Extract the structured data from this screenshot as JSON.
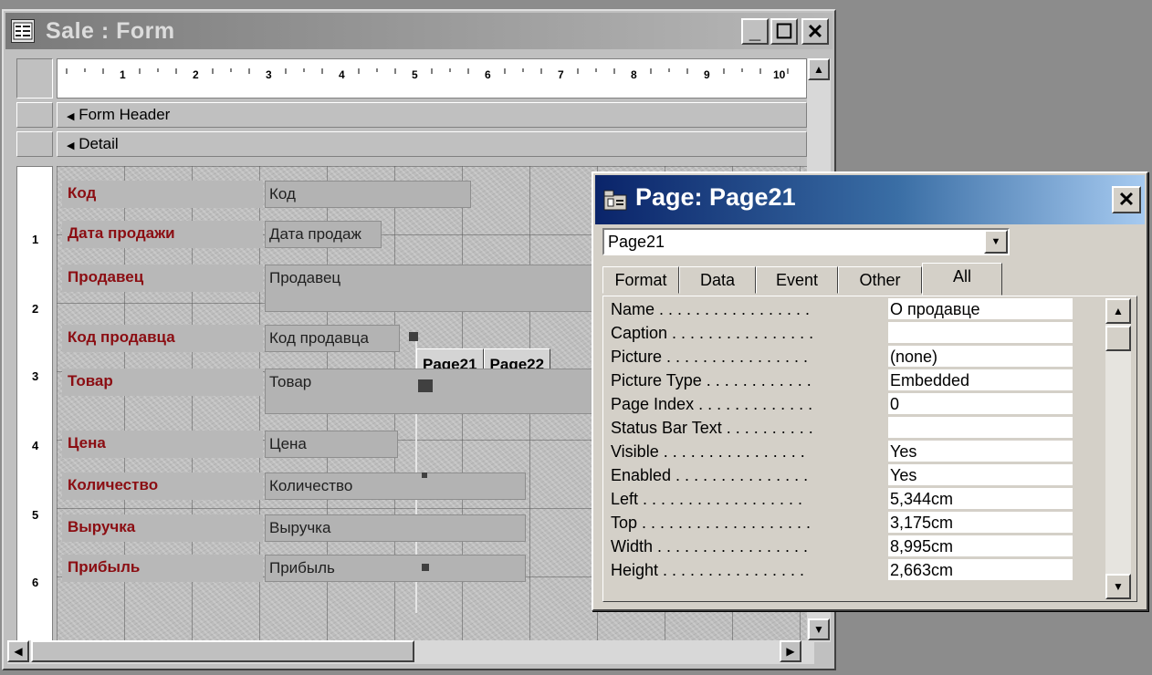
{
  "form_window": {
    "title": "Sale : Form",
    "minimize_glyph": "_",
    "maximize_glyph": "☐",
    "close_glyph": "✕",
    "ruler_numbers": [
      "1",
      "2",
      "3",
      "4",
      "5",
      "6",
      "7",
      "8",
      "9",
      "10"
    ],
    "vruler_numbers": [
      "1",
      "2",
      "3",
      "4",
      "5",
      "6"
    ],
    "sections": {
      "header": "Form Header",
      "detail": "Detail"
    },
    "controls": [
      {
        "label": "Код",
        "field": "Код"
      },
      {
        "label": "Дата продажи",
        "field": "Дата продаж"
      },
      {
        "label": "Продавец",
        "field": "Продавец"
      },
      {
        "label": "Код продавца",
        "field": "Код продавца"
      },
      {
        "label": "Товар",
        "field": "Товар"
      },
      {
        "label": "Цена",
        "field": "Цена"
      },
      {
        "label": "Количество",
        "field": "Количество"
      },
      {
        "label": "Выручка",
        "field": "Выручка"
      },
      {
        "label": "Прибыль",
        "field": "Прибыль"
      }
    ],
    "tab_control": {
      "tabs": [
        "Page21",
        "Page22"
      ]
    }
  },
  "property_sheet": {
    "title": "Page: Page21",
    "close_glyph": "✕",
    "object_select": "Page21",
    "tabs": [
      "Format",
      "Data",
      "Event",
      "Other",
      "All"
    ],
    "active_tab": "All",
    "properties": [
      {
        "name": "Name . . . . . . . . . . . . . . . . .",
        "value": "О продавце"
      },
      {
        "name": "Caption . . . . . . . . . . . . . . . .",
        "value": ""
      },
      {
        "name": "Picture . . . . . . . . . . . . . . . .",
        "value": "(none)"
      },
      {
        "name": "Picture Type . . . . . . . . . . . .",
        "value": "Embedded"
      },
      {
        "name": "Page Index . . . . . . . . . . . . .",
        "value": "0"
      },
      {
        "name": "Status Bar Text . . . . . . . . . .",
        "value": ""
      },
      {
        "name": "Visible . . . . . . . . . . . . . . . .",
        "value": "Yes"
      },
      {
        "name": "Enabled . . . . . . . . . . . . . . .",
        "value": "Yes"
      },
      {
        "name": "Left . . . . . . . . . . . . . . . . . .",
        "value": "5,344cm"
      },
      {
        "name": "Top . . . . . . . . . . . . . . . . . . .",
        "value": "3,175cm"
      },
      {
        "name": "Width . . . . . . . . . . . . . . . . .",
        "value": "8,995cm"
      },
      {
        "name": "Height . . . . . . . . . . . . . . . .",
        "value": "2,663cm"
      }
    ]
  },
  "icons": {
    "form_icon": "form-view-icon",
    "page_icon": "page-property-icon",
    "scroll_up": "▲",
    "scroll_down": "▼",
    "scroll_left": "◀",
    "scroll_right": "▶",
    "dropdown": "▼",
    "section_marker": "▼"
  },
  "colors": {
    "label_text": "#8b0d12",
    "active_title": "#0a246a"
  }
}
